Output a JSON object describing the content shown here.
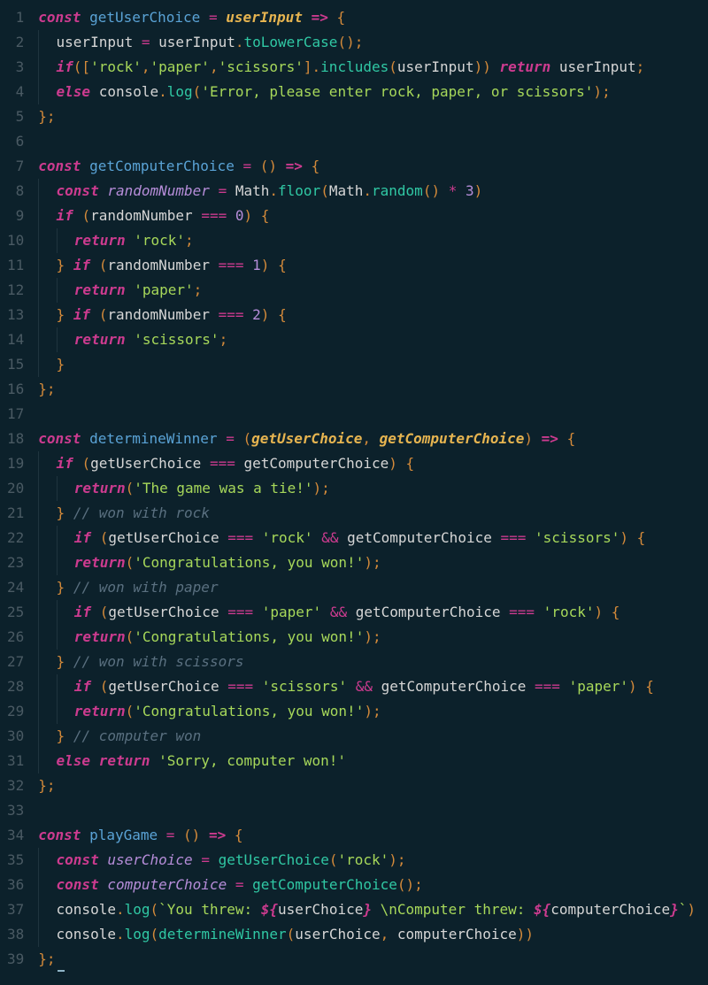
{
  "lineCount": 39,
  "code": {
    "l1": [
      [
        "kw",
        "const "
      ],
      [
        "fn",
        "getUserChoice"
      ],
      [
        "id",
        " "
      ],
      [
        "op",
        "="
      ],
      [
        "id",
        " "
      ],
      [
        "param",
        "userInput"
      ],
      [
        "id",
        " "
      ],
      [
        "kw",
        "=>"
      ],
      [
        "id",
        " "
      ],
      [
        "punc",
        "{"
      ]
    ],
    "l2": [
      [
        "id",
        "userInput "
      ],
      [
        "op",
        "="
      ],
      [
        "id",
        " userInput"
      ],
      [
        "punc",
        "."
      ],
      [
        "method",
        "toLowerCase"
      ],
      [
        "punc",
        "()"
      ],
      [
        "punc",
        ";"
      ]
    ],
    "l3": [
      [
        "kw",
        "if"
      ],
      [
        "punc",
        "(["
      ],
      [
        "str",
        "'rock'"
      ],
      [
        "punc",
        ","
      ],
      [
        "str",
        "'paper'"
      ],
      [
        "punc",
        ","
      ],
      [
        "str",
        "'scissors'"
      ],
      [
        "punc",
        "]."
      ],
      [
        "method",
        "includes"
      ],
      [
        "punc",
        "("
      ],
      [
        "id",
        "userInput"
      ],
      [
        "punc",
        "))"
      ],
      [
        "id",
        " "
      ],
      [
        "kw",
        "return"
      ],
      [
        "id",
        " userInput"
      ],
      [
        "punc",
        ";"
      ]
    ],
    "l4": [
      [
        "kw",
        "else"
      ],
      [
        "id",
        " console"
      ],
      [
        "punc",
        "."
      ],
      [
        "method",
        "log"
      ],
      [
        "punc",
        "("
      ],
      [
        "str",
        "'Error, please enter rock, paper, or scissors'"
      ],
      [
        "punc",
        ")"
      ],
      [
        "punc",
        ";"
      ]
    ],
    "l5": [
      [
        "punc",
        "}"
      ],
      [
        "punc",
        ";"
      ]
    ],
    "l6": [],
    "l7": [
      [
        "kw",
        "const "
      ],
      [
        "fn",
        "getComputerChoice"
      ],
      [
        "id",
        " "
      ],
      [
        "op",
        "="
      ],
      [
        "id",
        " "
      ],
      [
        "punc",
        "()"
      ],
      [
        "id",
        " "
      ],
      [
        "kw",
        "=>"
      ],
      [
        "id",
        " "
      ],
      [
        "punc",
        "{"
      ]
    ],
    "l8": [
      [
        "kw",
        "const"
      ],
      [
        "id",
        " "
      ],
      [
        "prop",
        "randomNumber"
      ],
      [
        "id",
        " "
      ],
      [
        "op",
        "="
      ],
      [
        "id",
        " Math"
      ],
      [
        "punc",
        "."
      ],
      [
        "method",
        "floor"
      ],
      [
        "punc",
        "("
      ],
      [
        "id",
        "Math"
      ],
      [
        "punc",
        "."
      ],
      [
        "method",
        "random"
      ],
      [
        "punc",
        "()"
      ],
      [
        "id",
        " "
      ],
      [
        "op",
        "*"
      ],
      [
        "id",
        " "
      ],
      [
        "num",
        "3"
      ],
      [
        "punc",
        ")"
      ]
    ],
    "l9": [
      [
        "kw",
        "if"
      ],
      [
        "id",
        " "
      ],
      [
        "punc",
        "("
      ],
      [
        "id",
        "randomNumber "
      ],
      [
        "op",
        "==="
      ],
      [
        "id",
        " "
      ],
      [
        "num",
        "0"
      ],
      [
        "punc",
        ")"
      ],
      [
        "id",
        " "
      ],
      [
        "punc",
        "{"
      ]
    ],
    "l10": [
      [
        "kw",
        "return"
      ],
      [
        "id",
        " "
      ],
      [
        "str",
        "'rock'"
      ],
      [
        "punc",
        ";"
      ]
    ],
    "l11": [
      [
        "punc",
        "}"
      ],
      [
        "id",
        " "
      ],
      [
        "kw",
        "if"
      ],
      [
        "id",
        " "
      ],
      [
        "punc",
        "("
      ],
      [
        "id",
        "randomNumber "
      ],
      [
        "op",
        "==="
      ],
      [
        "id",
        " "
      ],
      [
        "num",
        "1"
      ],
      [
        "punc",
        ")"
      ],
      [
        "id",
        " "
      ],
      [
        "punc",
        "{"
      ]
    ],
    "l12": [
      [
        "kw",
        "return"
      ],
      [
        "id",
        " "
      ],
      [
        "str",
        "'paper'"
      ],
      [
        "punc",
        ";"
      ]
    ],
    "l13": [
      [
        "punc",
        "}"
      ],
      [
        "id",
        " "
      ],
      [
        "kw",
        "if"
      ],
      [
        "id",
        " "
      ],
      [
        "punc",
        "("
      ],
      [
        "id",
        "randomNumber "
      ],
      [
        "op",
        "==="
      ],
      [
        "id",
        " "
      ],
      [
        "num",
        "2"
      ],
      [
        "punc",
        ")"
      ],
      [
        "id",
        " "
      ],
      [
        "punc",
        "{"
      ]
    ],
    "l14": [
      [
        "kw",
        "return"
      ],
      [
        "id",
        " "
      ],
      [
        "str",
        "'scissors'"
      ],
      [
        "punc",
        ";"
      ]
    ],
    "l15": [
      [
        "punc",
        "}"
      ]
    ],
    "l16": [
      [
        "punc",
        "}"
      ],
      [
        "punc",
        ";"
      ]
    ],
    "l17": [],
    "l18": [
      [
        "kw",
        "const "
      ],
      [
        "fn",
        "determineWinner"
      ],
      [
        "id",
        " "
      ],
      [
        "op",
        "="
      ],
      [
        "id",
        " "
      ],
      [
        "punc",
        "("
      ],
      [
        "param",
        "getUserChoice"
      ],
      [
        "punc",
        ", "
      ],
      [
        "param",
        "getComputerChoice"
      ],
      [
        "punc",
        ")"
      ],
      [
        "id",
        " "
      ],
      [
        "kw",
        "=>"
      ],
      [
        "id",
        " "
      ],
      [
        "punc",
        "{"
      ]
    ],
    "l19": [
      [
        "kw",
        "if"
      ],
      [
        "id",
        " "
      ],
      [
        "punc",
        "("
      ],
      [
        "id",
        "getUserChoice "
      ],
      [
        "op",
        "==="
      ],
      [
        "id",
        " getComputerChoice"
      ],
      [
        "punc",
        ")"
      ],
      [
        "id",
        " "
      ],
      [
        "punc",
        "{"
      ]
    ],
    "l20": [
      [
        "kw",
        "return"
      ],
      [
        "punc",
        "("
      ],
      [
        "str",
        "'The game was a tie!'"
      ],
      [
        "punc",
        ")"
      ],
      [
        "punc",
        ";"
      ]
    ],
    "l21": [
      [
        "punc",
        "}"
      ],
      [
        "id",
        " "
      ],
      [
        "comment",
        "// won with rock"
      ]
    ],
    "l22": [
      [
        "kw",
        "if"
      ],
      [
        "id",
        " "
      ],
      [
        "punc",
        "("
      ],
      [
        "id",
        "getUserChoice "
      ],
      [
        "op",
        "==="
      ],
      [
        "id",
        " "
      ],
      [
        "str",
        "'rock'"
      ],
      [
        "id",
        " "
      ],
      [
        "op",
        "&&"
      ],
      [
        "id",
        " getComputerChoice "
      ],
      [
        "op",
        "==="
      ],
      [
        "id",
        " "
      ],
      [
        "str",
        "'scissors'"
      ],
      [
        "punc",
        ")"
      ],
      [
        "id",
        " "
      ],
      [
        "punc",
        "{"
      ]
    ],
    "l23": [
      [
        "kw",
        "return"
      ],
      [
        "punc",
        "("
      ],
      [
        "str",
        "'Congratulations, you won!'"
      ],
      [
        "punc",
        ")"
      ],
      [
        "punc",
        ";"
      ]
    ],
    "l24": [
      [
        "punc",
        "}"
      ],
      [
        "id",
        " "
      ],
      [
        "comment",
        "// won with paper"
      ]
    ],
    "l25": [
      [
        "kw",
        "if"
      ],
      [
        "id",
        " "
      ],
      [
        "punc",
        "("
      ],
      [
        "id",
        "getUserChoice "
      ],
      [
        "op",
        "==="
      ],
      [
        "id",
        " "
      ],
      [
        "str",
        "'paper'"
      ],
      [
        "id",
        " "
      ],
      [
        "op",
        "&&"
      ],
      [
        "id",
        " getComputerChoice "
      ],
      [
        "op",
        "==="
      ],
      [
        "id",
        " "
      ],
      [
        "str",
        "'rock'"
      ],
      [
        "punc",
        ")"
      ],
      [
        "id",
        " "
      ],
      [
        "punc",
        "{"
      ]
    ],
    "l26": [
      [
        "kw",
        "return"
      ],
      [
        "punc",
        "("
      ],
      [
        "str",
        "'Congratulations, you won!'"
      ],
      [
        "punc",
        ")"
      ],
      [
        "punc",
        ";"
      ]
    ],
    "l27": [
      [
        "punc",
        "}"
      ],
      [
        "id",
        " "
      ],
      [
        "comment",
        "// won with scissors"
      ]
    ],
    "l28": [
      [
        "kw",
        "if"
      ],
      [
        "id",
        " "
      ],
      [
        "punc",
        "("
      ],
      [
        "id",
        "getUserChoice "
      ],
      [
        "op",
        "==="
      ],
      [
        "id",
        " "
      ],
      [
        "str",
        "'scissors'"
      ],
      [
        "id",
        " "
      ],
      [
        "op",
        "&&"
      ],
      [
        "id",
        " getComputerChoice "
      ],
      [
        "op",
        "==="
      ],
      [
        "id",
        " "
      ],
      [
        "str",
        "'paper'"
      ],
      [
        "punc",
        ")"
      ],
      [
        "id",
        " "
      ],
      [
        "punc",
        "{"
      ]
    ],
    "l29": [
      [
        "kw",
        "return"
      ],
      [
        "punc",
        "("
      ],
      [
        "str",
        "'Congratulations, you won!'"
      ],
      [
        "punc",
        ")"
      ],
      [
        "punc",
        ";"
      ]
    ],
    "l30": [
      [
        "punc",
        "}"
      ],
      [
        "id",
        " "
      ],
      [
        "comment",
        "// computer won"
      ]
    ],
    "l31": [
      [
        "kw",
        "else"
      ],
      [
        "id",
        " "
      ],
      [
        "kw",
        "return"
      ],
      [
        "id",
        " "
      ],
      [
        "str",
        "'Sorry, computer won!'"
      ]
    ],
    "l32": [
      [
        "punc",
        "}"
      ],
      [
        "punc",
        ";"
      ]
    ],
    "l33": [],
    "l34": [
      [
        "kw",
        "const "
      ],
      [
        "fn",
        "playGame"
      ],
      [
        "id",
        " "
      ],
      [
        "op",
        "="
      ],
      [
        "id",
        " "
      ],
      [
        "punc",
        "()"
      ],
      [
        "id",
        " "
      ],
      [
        "kw",
        "=>"
      ],
      [
        "id",
        " "
      ],
      [
        "punc",
        "{"
      ]
    ],
    "l35": [
      [
        "kw",
        "const"
      ],
      [
        "id",
        " "
      ],
      [
        "prop",
        "userChoice"
      ],
      [
        "id",
        " "
      ],
      [
        "op",
        "="
      ],
      [
        "id",
        " "
      ],
      [
        "method",
        "getUserChoice"
      ],
      [
        "punc",
        "("
      ],
      [
        "str",
        "'rock'"
      ],
      [
        "punc",
        ")"
      ],
      [
        "punc",
        ";"
      ]
    ],
    "l36": [
      [
        "kw",
        "const"
      ],
      [
        "id",
        " "
      ],
      [
        "prop",
        "computerChoice"
      ],
      [
        "id",
        " "
      ],
      [
        "op",
        "="
      ],
      [
        "id",
        " "
      ],
      [
        "method",
        "getComputerChoice"
      ],
      [
        "punc",
        "()"
      ],
      [
        "punc",
        ";"
      ]
    ],
    "l37": [
      [
        "id",
        "console"
      ],
      [
        "punc",
        "."
      ],
      [
        "method",
        "log"
      ],
      [
        "punc",
        "("
      ],
      [
        "str",
        "`You threw: "
      ],
      [
        "kw",
        "${"
      ],
      [
        "id",
        "userChoice"
      ],
      [
        "kw",
        "}"
      ],
      [
        "str",
        " \\nComputer threw: "
      ],
      [
        "kw",
        "${"
      ],
      [
        "id",
        "computerChoice"
      ],
      [
        "kw",
        "}"
      ],
      [
        "str",
        "`"
      ],
      [
        "punc",
        ")"
      ]
    ],
    "l38": [
      [
        "id",
        "console"
      ],
      [
        "punc",
        "."
      ],
      [
        "method",
        "log"
      ],
      [
        "punc",
        "("
      ],
      [
        "method",
        "determineWinner"
      ],
      [
        "punc",
        "("
      ],
      [
        "id",
        "userChoice"
      ],
      [
        "punc",
        ", "
      ],
      [
        "id",
        "computerChoice"
      ],
      [
        "punc",
        "))"
      ]
    ],
    "l39": [
      [
        "punc",
        "}"
      ],
      [
        "punc",
        ";"
      ]
    ]
  },
  "indent": {
    "l1": 0,
    "l2": 1,
    "l3": 1,
    "l4": 1,
    "l5": 0,
    "l6": 0,
    "l7": 0,
    "l8": 1,
    "l9": 1,
    "l10": 2,
    "l11": 1,
    "l12": 2,
    "l13": 1,
    "l14": 2,
    "l15": 1,
    "l16": 0,
    "l17": 0,
    "l18": 0,
    "l19": 1,
    "l20": 2,
    "l21": 1,
    "l22": 2,
    "l23": 2,
    "l24": 1,
    "l25": 2,
    "l26": 2,
    "l27": 1,
    "l28": 2,
    "l29": 2,
    "l30": 1,
    "l31": 1,
    "l32": 0,
    "l33": 0,
    "l34": 0,
    "l35": 1,
    "l36": 1,
    "l37": 1,
    "l38": 1,
    "l39": 0
  }
}
